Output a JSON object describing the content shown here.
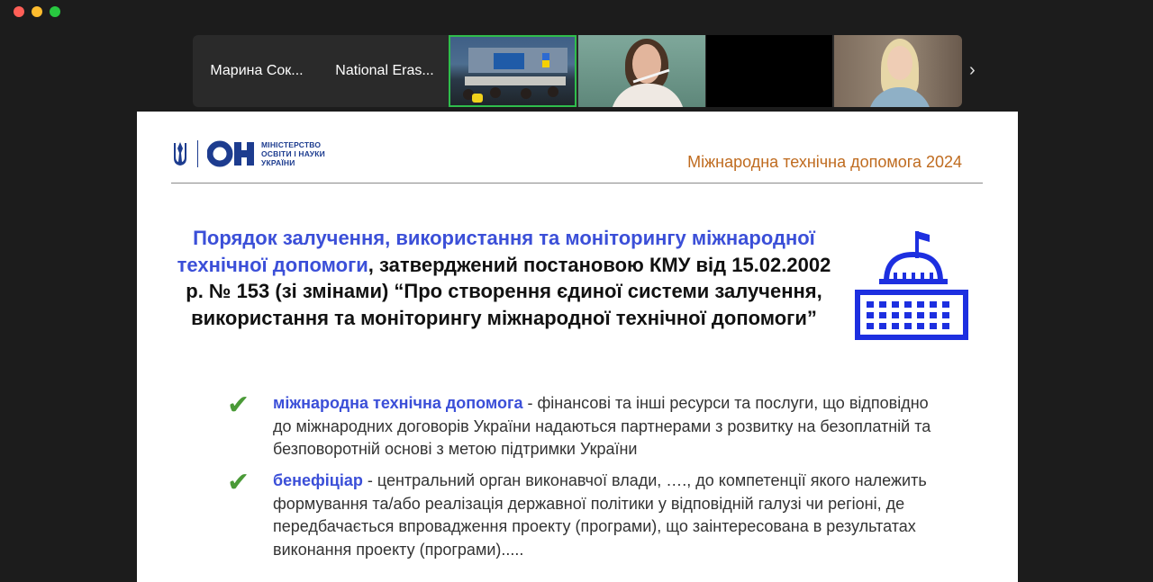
{
  "participants": [
    {
      "name": "Марина Сок..."
    },
    {
      "name": "National Eras..."
    }
  ],
  "slide": {
    "logo_lines": [
      "МІНІСТЕРСТВО",
      "ОСВІТИ І НАУКИ",
      "УКРАЇНИ"
    ],
    "header_title": "Міжнародна технічна допомога 2024",
    "title": {
      "blue_part": "Порядок залучення, використання та моніторингу міжнародної технічної допомоги",
      "rest_part": ", затверджений постановою КМУ від 15.02.2002 р. № 153 (зі змінами) “Про створення єдиної системи залучення, використання та моніторингу міжнародної технічної допомоги”"
    },
    "bullets": [
      {
        "term": "міжнародна технічна допомога",
        "text": " - фінансові та інші ресурси та послуги, що відповідно до міжнародних договорів України надаються партнерами з розвитку на безоплатній та безповоротній основі з метою підтримки України"
      },
      {
        "term": "бенефіціар",
        "text": " - центральний орган виконавчої влади, …., до компетенції якого належить формування та/або реалізація державної політики у відповідній галузі чи регіоні, де передбачається впровадження проекту (програми), що заінтересована в результатах виконання проекту (програми)....."
      }
    ]
  },
  "colors": {
    "accent_blue": "#3b4fd8",
    "header_orange": "#bf6b1f",
    "check_green": "#4a9a37",
    "active_speaker": "#2fbd4c"
  }
}
